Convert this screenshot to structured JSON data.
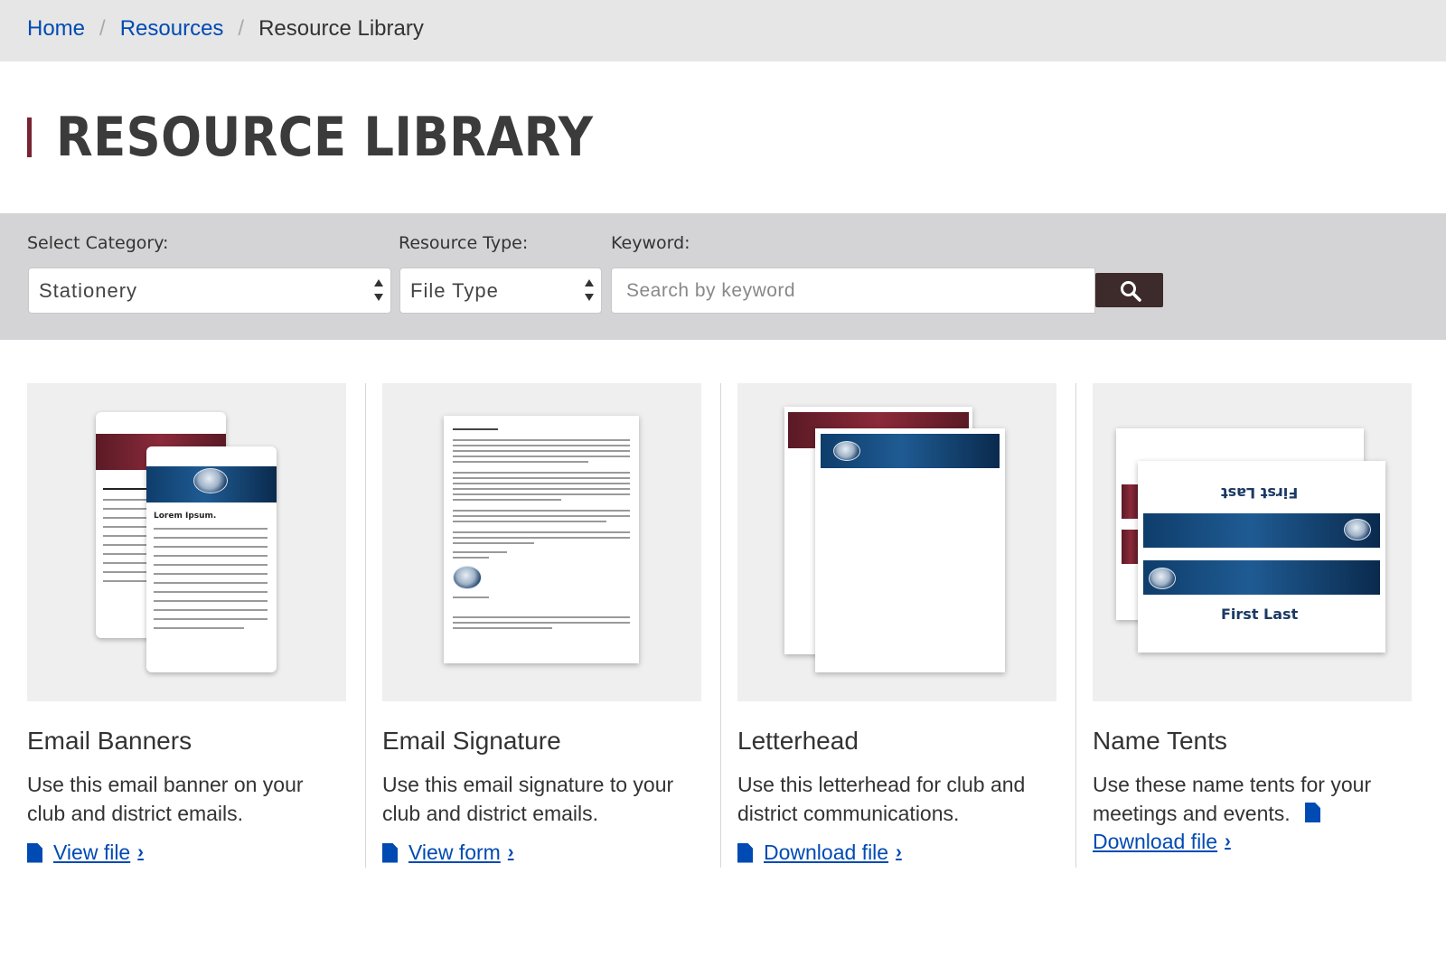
{
  "breadcrumb": {
    "home": "Home",
    "resources": "Resources",
    "current": "Resource Library"
  },
  "page": {
    "title": "RESOURCE LIBRARY"
  },
  "filters": {
    "category_label": "Select Category:",
    "category_value": "Stationery",
    "type_label": "Resource Type:",
    "type_value": "File Type",
    "keyword_label": "Keyword:",
    "keyword_placeholder": "Search by keyword"
  },
  "cards": [
    {
      "title": "Email Banners",
      "desc": "Use this email banner on your club and district emails.",
      "link": "View file"
    },
    {
      "title": "Email Signature",
      "desc": "Use this email signature to your club and district emails.",
      "link": "View form"
    },
    {
      "title": "Letterhead",
      "desc": "Use this letterhead for club and district communications.",
      "link": "Download file"
    },
    {
      "title": "Name Tents",
      "desc": "Use these name tents for your meetings and events.",
      "link": "Download file"
    }
  ],
  "thumb_text": {
    "lorem_heading": "Lorem Ipsum.",
    "tent_name": "First Last"
  },
  "colors": {
    "link": "#004ab3",
    "accent": "#772432",
    "search_button": "#3d2a2b",
    "filter_bar": "#d4d4d6"
  },
  "icons": [
    "file-icon",
    "search-icon",
    "chevron-right-icon",
    "select-arrows-icon"
  ]
}
